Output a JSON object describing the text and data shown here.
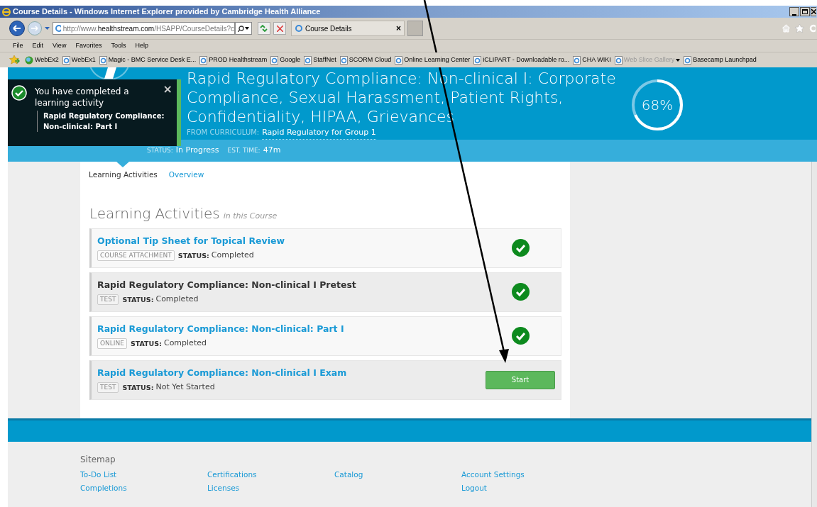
{
  "window": {
    "title": "Course Details - Windows Internet Explorer provided by Cambridge Health Alliance"
  },
  "address_bar": {
    "url_prefix": "http://www.",
    "url_domain": "healthstream.com",
    "url_path": "/HSAPP/CourseDetails?c"
  },
  "tab": {
    "title": "Course Details",
    "close": "×"
  },
  "menu": [
    "File",
    "Edit",
    "View",
    "Favorites",
    "Tools",
    "Help"
  ],
  "favorites": [
    {
      "label": "WebEx2",
      "kind": "globe",
      "disabled": false
    },
    {
      "label": "WebEx1",
      "kind": "page",
      "disabled": false
    },
    {
      "label": "Magic - BMC Service Desk E...",
      "kind": "page",
      "disabled": false
    },
    {
      "label": "PROD Healthstream",
      "kind": "page",
      "disabled": false
    },
    {
      "label": "Google",
      "kind": "page",
      "disabled": false
    },
    {
      "label": "StaffNet",
      "kind": "page",
      "disabled": false
    },
    {
      "label": "SCORM Cloud",
      "kind": "page",
      "disabled": false
    },
    {
      "label": "Online Learning Center",
      "kind": "page",
      "disabled": false
    },
    {
      "label": "iCLIPART - Downloadable ro...",
      "kind": "page",
      "disabled": false
    },
    {
      "label": "CHA WIKI",
      "kind": "page",
      "disabled": false
    },
    {
      "label": "Web Slice Gallery",
      "kind": "dropdown",
      "disabled": true
    },
    {
      "label": "Basecamp Launchpad",
      "kind": "page",
      "disabled": false
    }
  ],
  "course": {
    "title_line_1": "Rapid Regulatory Compliance: Non-clinical I:",
    "title_rest": "Corporate Compliance, Sexual Harassment, Patient Rights, Confidentiality, HIPAA, Grievances",
    "curriculum_label": "FROM CURRICULUM:",
    "curriculum": "Rapid Regulatory for Group 1",
    "status_label": "STATUS:",
    "status": "In Progress",
    "time_label": "EST. TIME:",
    "time": "47m",
    "progress": {
      "level": 0.68,
      "reading": "68%"
    }
  },
  "toast": {
    "message": "You have completed a learning activity",
    "activity": "Rapid Regulatory Compliance: Non-clinical: Part I",
    "close": "×"
  },
  "tabs": [
    {
      "label": "Learning Activities",
      "selected": true
    },
    {
      "label": "Overview",
      "selected": false
    }
  ],
  "section": {
    "title": "Learning Activities",
    "subtitle": "in this Course"
  },
  "activities": [
    {
      "title": "Optional Tip Sheet for Topical Review",
      "link": true,
      "type": "COURSE ATTACHMENT",
      "status_label": "STATUS:",
      "status": "Completed",
      "completed": true,
      "shaded": false
    },
    {
      "title": "Rapid Regulatory Compliance: Non-clinical I Pretest",
      "link": false,
      "type": "TEST",
      "status_label": "STATUS:",
      "status": "Completed",
      "completed": true,
      "shaded": true
    },
    {
      "title": "Rapid Regulatory Compliance: Non-clinical: Part I",
      "link": true,
      "type": "ONLINE",
      "status_label": "STATUS:",
      "status": "Completed",
      "completed": true,
      "shaded": false
    },
    {
      "title": "Rapid Regulatory Compliance: Non-clinical I Exam",
      "link": true,
      "type": "TEST",
      "status_label": "STATUS:",
      "status": "Not Yet Started",
      "completed": false,
      "action": "Start",
      "shaded": true
    }
  ],
  "footer": {
    "title": "Sitemap",
    "columns": [
      [
        "To-Do List",
        "Completions"
      ],
      [
        "Certifications",
        "Licenses"
      ],
      [
        "Catalog"
      ],
      [
        "Account Settings",
        "Logout"
      ]
    ]
  }
}
